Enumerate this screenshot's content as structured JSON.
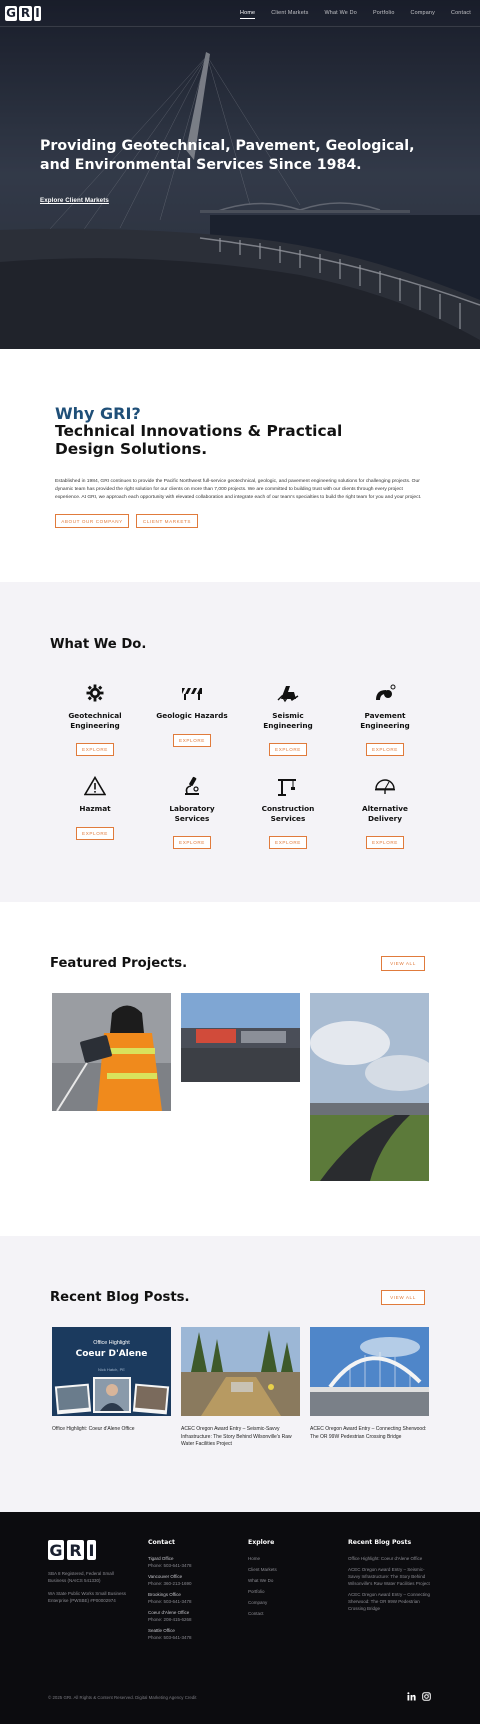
{
  "header": {
    "logo_letters": [
      "G",
      "R",
      "I"
    ],
    "nav": [
      "Home",
      "Client Markets",
      "What We Do",
      "Portfolio",
      "Company",
      "Contact"
    ]
  },
  "hero": {
    "title": "Providing Geotechnical, Pavement, Geological, and Environmental Services Since 1984.",
    "link": "Explore Client Markets"
  },
  "why": {
    "kicker": "Why GRI?",
    "heading": "Technical Innovations & Practical Design Solutions.",
    "body": "Established in 1984, GRI continues to provide the Pacific Northwest full-service geotechnical, geologic, and pavement engineering solutions for challenging projects. Our dynamic team has provided the right solution for our clients on more than 7,000 projects. We are committed to building trust with our clients through every project experience. At GRI, we approach each opportunity with elevated collaboration and integrate each of our team's specialties to build the right team for you and your project.",
    "button_about": "ABOUT OUR COMPANY",
    "button_markets": "CLIENT MARKETS"
  },
  "what": {
    "title": "What We Do.",
    "explore_label": "EXPLORE",
    "services": [
      {
        "name": "Geotechnical Engineering",
        "icon": "gear-icon"
      },
      {
        "name": "Geologic Hazards",
        "icon": "barricade-icon"
      },
      {
        "name": "Seismic Engineering",
        "icon": "seismic-icon"
      },
      {
        "name": "Pavement Engineering",
        "icon": "pavement-icon"
      },
      {
        "name": "Hazmat",
        "icon": "warning-icon"
      },
      {
        "name": "Laboratory Services",
        "icon": "microscope-icon"
      },
      {
        "name": "Construction Services",
        "icon": "crane-icon"
      },
      {
        "name": "Alternative Delivery",
        "icon": "protractor-icon"
      }
    ]
  },
  "projects": {
    "title": "Featured Projects.",
    "view_all": "VIEW ALL"
  },
  "blog": {
    "title": "Recent Blog Posts.",
    "view_all": "VIEW ALL",
    "card1_overlay_small": "Office Highlight",
    "card1_overlay_big": "Coeur D'Alene",
    "card1_overlay_name": "Nick Hatch, PE",
    "posts": [
      "Office Highlight: Coeur d'Alene Office",
      "ACEC Oregon Award Entry – Seismic-Savvy Infrastructure: The Story Behind Wilsonville's Raw Water Facilities Project",
      "ACEC Oregon Award Entry – Connecting Sherwood: The OR 99W Pedestrian Crossing Bridge"
    ]
  },
  "footer": {
    "about_1": "SBA 8 Registered, Federal Small Business (NAICS 541330)",
    "about_2": "WA State Public Works Small Business Enterprise (PWSBE) #P00002974",
    "contact_title": "Contact",
    "offices": [
      {
        "name": "Tigard Office",
        "phone": "Phone: 503-641-3478"
      },
      {
        "name": "Vancouver Office",
        "phone": "Phone: 360-213-1690"
      },
      {
        "name": "Brookings Office",
        "phone": "Phone: 503-641-3478"
      },
      {
        "name": "Coeur d'Alene Office",
        "phone": "Phone: 208-415-6268"
      },
      {
        "name": "Seattle Office",
        "phone": "Phone: 503-641-3478"
      }
    ],
    "explore_title": "Explore",
    "explore_links": [
      "Home",
      "Client Markets",
      "What We Do",
      "Portfolio",
      "Company",
      "Contact"
    ],
    "recent_title": "Recent Blog Posts",
    "recent_links": [
      "Office Highlight: Coeur d'Alene Office",
      "ACEC Oregon Award Entry – Seismic-Savvy Infrastructure: The Story Behind Wilsonville's Raw Water Facilities Project",
      "ACEC Oregon Award Entry – Connecting Sherwood: The OR 99W Pedestrian Crossing Bridge"
    ],
    "copyright": "© 2025 GRI. All Rights & Content Reserved. Digital Marketing Agency Credit",
    "social": [
      "linkedin-icon",
      "instagram-icon"
    ]
  },
  "colors": {
    "accent_orange": "#e07b3c",
    "brand_blue": "#1f4f78",
    "footer_bg": "#0c0c0f",
    "section_gray": "#f4f3f7"
  }
}
